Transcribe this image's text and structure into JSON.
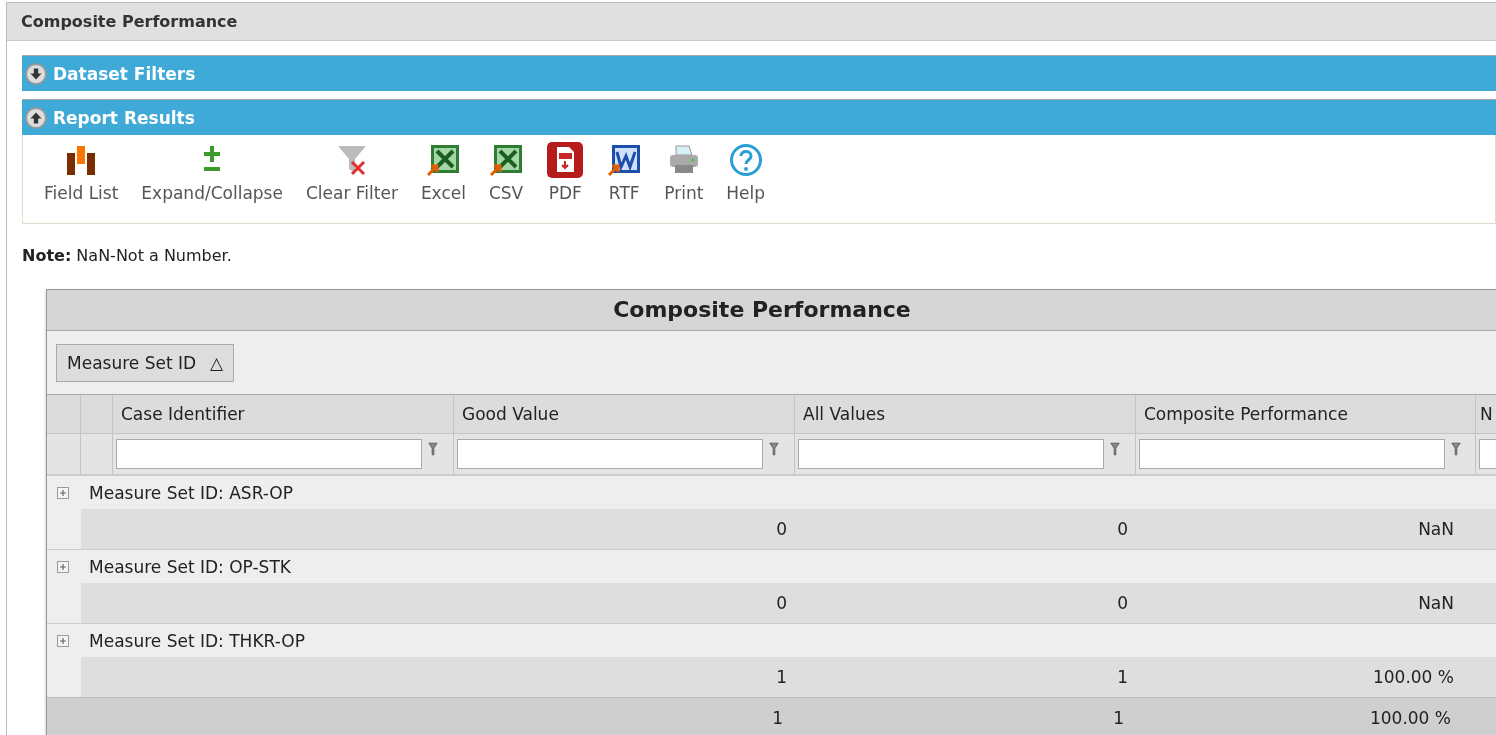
{
  "panel": {
    "title": "Composite Performance"
  },
  "sections": [
    {
      "title": "Dataset Filters",
      "expanded": false
    },
    {
      "title": "Report Results",
      "expanded": true
    }
  ],
  "toolbar": [
    {
      "label": "Field List",
      "kind": "fields"
    },
    {
      "label": "Expand/Collapse",
      "kind": "expand"
    },
    {
      "label": "Clear Filter",
      "kind": "clearfilter"
    },
    {
      "label": "Excel",
      "kind": "excel"
    },
    {
      "label": "CSV",
      "kind": "csv"
    },
    {
      "label": "PDF",
      "kind": "pdf"
    },
    {
      "label": "RTF",
      "kind": "rtf"
    },
    {
      "label": "Print",
      "kind": "print"
    },
    {
      "label": "Help",
      "kind": "help"
    }
  ],
  "note": "**Note:** NaN-Not a Number.",
  "table": {
    "title": "Composite Performance",
    "group_by": {
      "label": "Measure Set ID",
      "sort_icon": "△"
    },
    "columns": [
      "Case Identifier",
      "Good Value",
      "All Values",
      "Composite Performance",
      "N"
    ],
    "groups": [
      {
        "label": "Measure Set ID: ASR-OP",
        "expanded": false,
        "values": [
          "0",
          "0",
          "NaN"
        ]
      },
      {
        "label": "Measure Set ID: OP-STK",
        "expanded": false,
        "values": [
          "0",
          "0",
          "NaN"
        ]
      },
      {
        "label": "Measure Set ID: THKR-OP",
        "expanded": false,
        "values": [
          "1",
          "1",
          "100.00 %"
        ]
      }
    ],
    "total": [
      "1",
      "1",
      "100.00 %"
    ]
  }
}
